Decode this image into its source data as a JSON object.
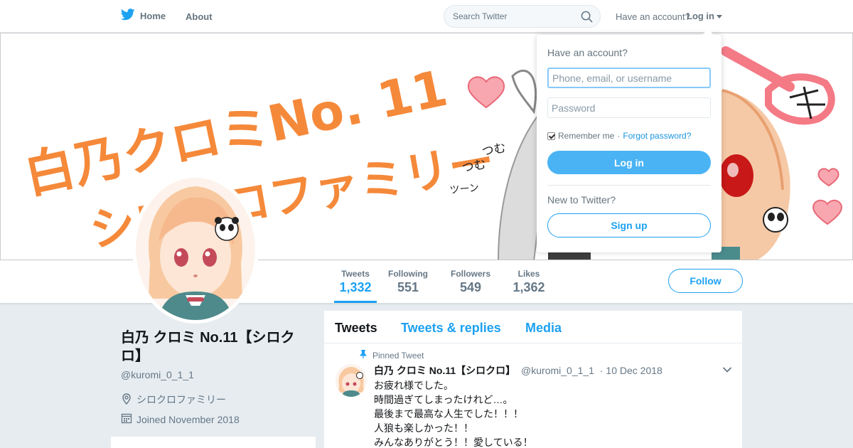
{
  "nav": {
    "home_label": "Home",
    "about_label": "About",
    "search_placeholder": "Search Twitter",
    "have_account": "Have an account?",
    "login_label": "Log in"
  },
  "banner": {
    "line1": "白乃クロミNo. 11",
    "line2": "シロクロファミリー",
    "sfx": [
      "つむ",
      "つむ",
      "ツーン"
    ]
  },
  "profile": {
    "name": "白乃 クロミ No.11【シロクロ】",
    "handle": "@kuromi_0_1_1",
    "location": "シロクロファミリー",
    "joined": "Joined November 2018"
  },
  "stats": [
    {
      "label": "Tweets",
      "value": "1,332"
    },
    {
      "label": "Following",
      "value": "551"
    },
    {
      "label": "Followers",
      "value": "549"
    },
    {
      "label": "Likes",
      "value": "1,362"
    }
  ],
  "follow_label": "Follow",
  "timeline": {
    "tabs": [
      "Tweets",
      "Tweets & replies",
      "Media"
    ],
    "pinned_label": "Pinned Tweet",
    "tweet": {
      "name": "白乃 クロミ No.11【シロクロ】",
      "handle": "@kuromi_0_1_1",
      "date": "· 10 Dec 2018",
      "lines": [
        "お疲れ様でした。",
        "時間過ぎてしまったけれど…。",
        "最後まで最高な人生でした！！！",
        "人狼も楽しかった！！",
        "みんなありがとう！！愛している！"
      ]
    }
  },
  "login_dropdown": {
    "title": "Have an account?",
    "username_placeholder": "Phone, email, or username",
    "password_placeholder": "Password",
    "remember_label": "Remember me",
    "separator": " · ",
    "forgot_label": "Forgot password?",
    "login_button": "Log in",
    "new_label": "New to Twitter?",
    "signup_button": "Sign up"
  },
  "colors": {
    "accent": "#1da1f2",
    "banner_text": "#f5893a",
    "heart": "#f47a86"
  }
}
